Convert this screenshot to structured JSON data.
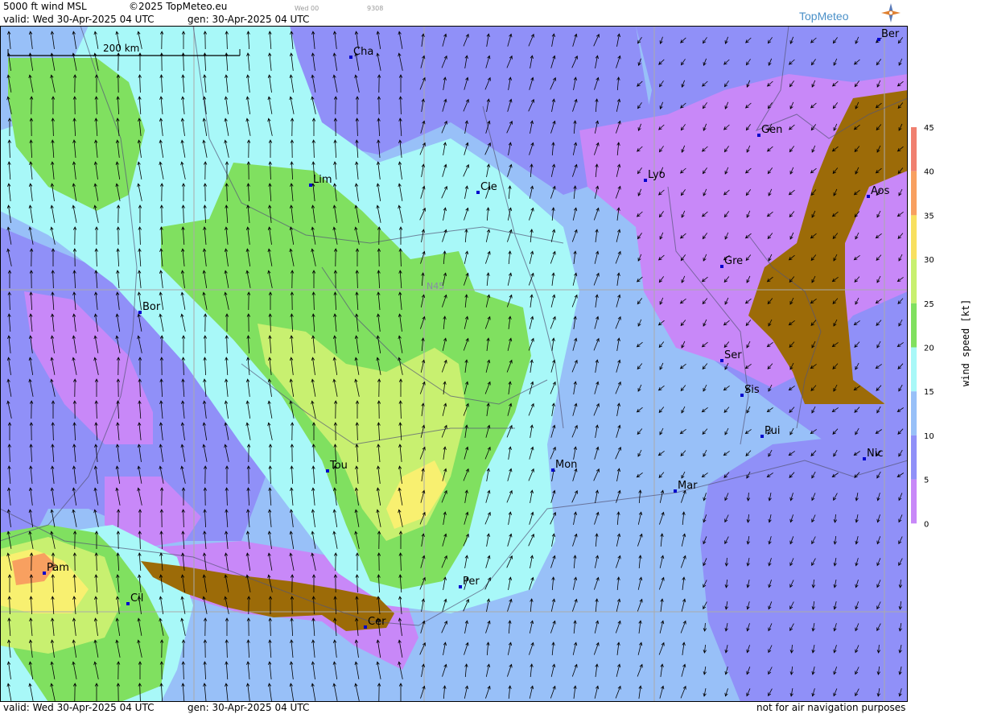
{
  "header": {
    "product": "5000 ft wind MSL",
    "copyright": "©2025 TopMeteo.eu",
    "run_small": "Wed 00",
    "code_small": "9308",
    "valid": "valid:  Wed  30-Apr-2025  04 UTC",
    "gen": "gen: 30-Apr-2025 04 UTC"
  },
  "brand": {
    "name": "TopMeteo"
  },
  "map": {
    "scale_label": "200 km",
    "grid_label": "N45",
    "cities": [
      {
        "id": "cha",
        "label": "Cha"
      },
      {
        "id": "ber",
        "label": "Ber"
      },
      {
        "id": "gen",
        "label": "Gen"
      },
      {
        "id": "lim",
        "label": "Lim"
      },
      {
        "id": "cle",
        "label": "Cle"
      },
      {
        "id": "lyo",
        "label": "Lyo"
      },
      {
        "id": "aos",
        "label": "Aos"
      },
      {
        "id": "gre",
        "label": "Gre"
      },
      {
        "id": "bor",
        "label": "Bor"
      },
      {
        "id": "ser",
        "label": "Ser"
      },
      {
        "id": "sis",
        "label": "Sis"
      },
      {
        "id": "pui",
        "label": "Pui"
      },
      {
        "id": "tou",
        "label": "Tou"
      },
      {
        "id": "mon",
        "label": "Mon"
      },
      {
        "id": "nic",
        "label": "Nic"
      },
      {
        "id": "mar",
        "label": "Mar"
      },
      {
        "id": "pam",
        "label": "Pam"
      },
      {
        "id": "per",
        "label": "Per"
      },
      {
        "id": "cil",
        "label": "Cil"
      },
      {
        "id": "cer",
        "label": "Cer"
      }
    ]
  },
  "legend": {
    "title": "wind speed [kt]",
    "ticks": [
      "45",
      "40",
      "35",
      "30",
      "25",
      "20",
      "15",
      "10",
      "5",
      "0"
    ],
    "colors": [
      "#f08070",
      "#f8a060",
      "#f8e060",
      "#c8f070",
      "#80e060",
      "#a8f8f8",
      "#98c0f8",
      "#9090f8",
      "#c888f8"
    ]
  },
  "footer": {
    "valid": "valid:  Wed  30-Apr-2025  04 UTC",
    "gen": "gen: 30-Apr-2025 04 UTC",
    "disclaimer": "not for air navigation purposes"
  }
}
